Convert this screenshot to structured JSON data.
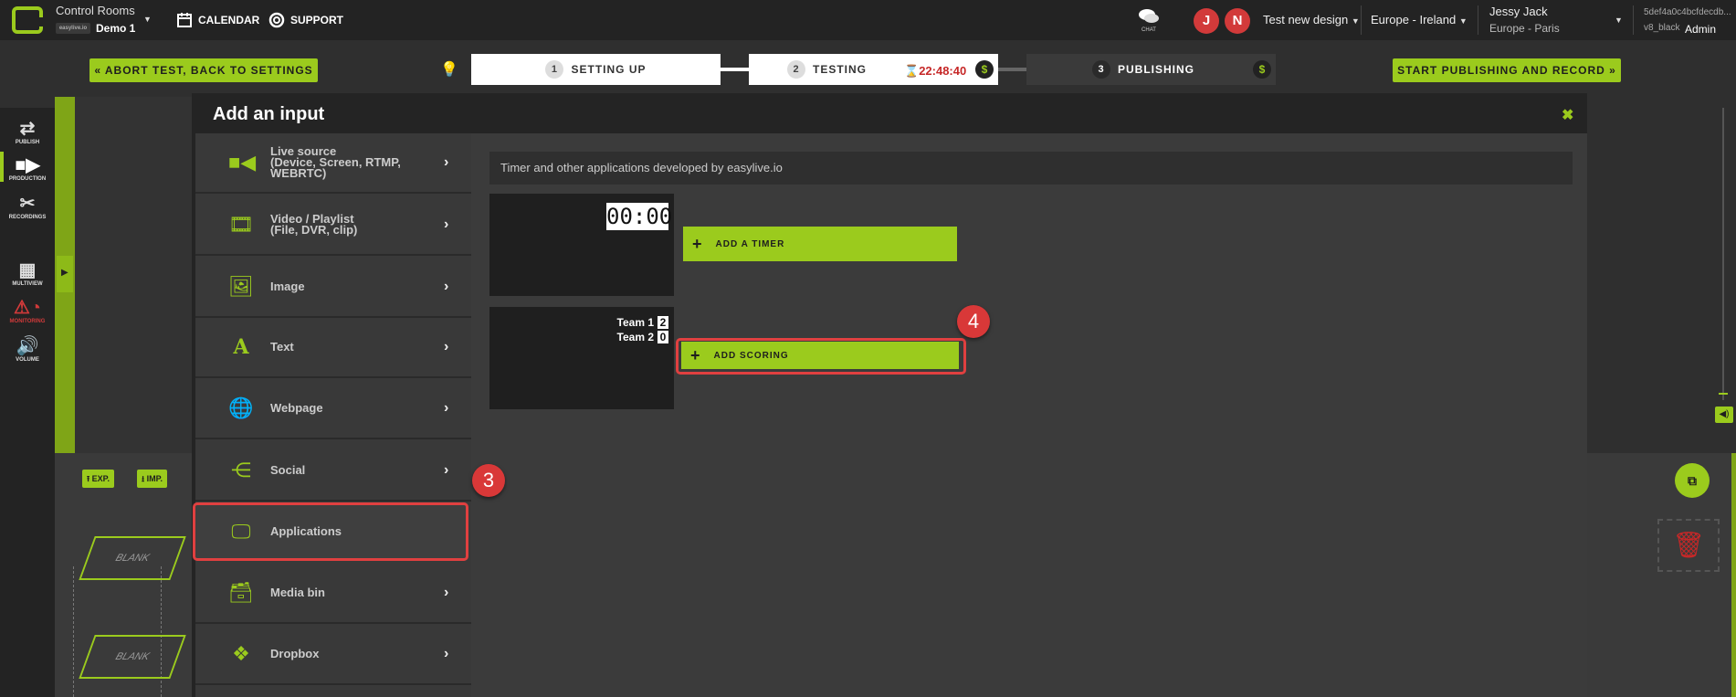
{
  "topbar": {
    "app_title": "Control Rooms",
    "workspace": "Demo 1",
    "mini_logo": "easylive.io",
    "calendar": "CALENDAR",
    "support": "SUPPORT",
    "chat": "CHAT",
    "avatar1": "J",
    "avatar2": "N",
    "design": "Test new design",
    "region": "Europe - Ireland",
    "user_name": "Jessy Jack",
    "user_location": "Europe - Paris",
    "account_id": "5def4a0c4bcfdecdb...",
    "account_theme": "v8_black",
    "account_role": "Admin"
  },
  "steps": {
    "abort": "ABORT TEST, BACK TO SETTINGS",
    "step1_num": "1",
    "step1": "SETTING UP",
    "step2_num": "2",
    "step2": "TESTING",
    "timer": "22:48:40",
    "step3_num": "3",
    "step3": "PUBLISHING",
    "dollar": "$",
    "start": "START PUBLISHING AND RECORD"
  },
  "sidebar": {
    "publish": "PUBLISH",
    "production": "PRODUCTION",
    "recordings": "RECORDINGS",
    "multiview": "MULTIVIEW",
    "monitoring": "MONITORING",
    "volume": "VOLUME"
  },
  "bg": {
    "exp": "EXP.",
    "imp": "IMP.",
    "blank1": "BLANK",
    "blank2": "BLANK"
  },
  "modal": {
    "title": "Add an input",
    "menu": [
      {
        "label": "Live source\n(Device, Screen, RTMP, WEBRTC)"
      },
      {
        "label": "Video / Playlist\n(File, DVR, clip)"
      },
      {
        "label": "Image"
      },
      {
        "label": "Text"
      },
      {
        "label": "Webpage"
      },
      {
        "label": "Social"
      },
      {
        "label": "Applications"
      },
      {
        "label": "Media bin"
      },
      {
        "label": "Dropbox"
      }
    ],
    "description": "Timer and other applications developed by easylive.io",
    "timer_preview": "00:00",
    "add_timer": "ADD A TIMER",
    "team1": "Team 1",
    "team1_score": "2",
    "team2": "Team 2",
    "team2_score": "0",
    "add_scoring": "ADD SCORING"
  },
  "callouts": {
    "c3": "3",
    "c4": "4"
  },
  "colors": {
    "accent": "#9bcb1d",
    "highlight": "#e04040",
    "timer_red": "#c62828"
  }
}
